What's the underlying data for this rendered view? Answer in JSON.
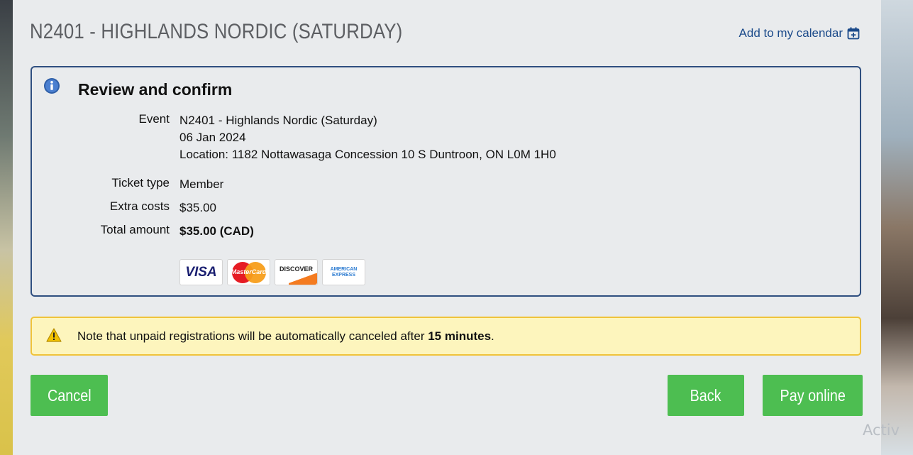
{
  "page": {
    "title": "N2401 - HIGHLANDS NORDIC (SATURDAY)",
    "calendar_link": "Add to my calendar"
  },
  "review": {
    "heading": "Review and confirm",
    "event_label": "Event",
    "event_name": "N2401 - Highlands Nordic (Saturday)",
    "event_date": "06 Jan 2024",
    "event_location": "Location: 1182 Nottawasaga Concession 10 S Duntroon, ON L0M 1H0",
    "ticket_label": "Ticket type",
    "ticket_value": "Member",
    "extra_label": "Extra costs",
    "extra_value": "$35.00",
    "total_label": "Total amount",
    "total_value": "$35.00 (CAD)",
    "payment_cards": [
      {
        "name": "VISA",
        "icon": "visa-card-icon"
      },
      {
        "name": "MasterCard",
        "icon": "mastercard-icon"
      },
      {
        "name": "DISCOVER",
        "icon": "discover-card-icon"
      },
      {
        "name": "AMERICAN EXPRESS",
        "icon": "amex-card-icon"
      }
    ]
  },
  "warning": {
    "text_before": "Note that unpaid registrations will be automatically canceled after ",
    "text_bold": "15 minutes",
    "text_after": "."
  },
  "buttons": {
    "cancel": "Cancel",
    "back": "Back",
    "pay": "Pay online"
  },
  "watermark": "Activ",
  "colors": {
    "button_green": "#4dbe51",
    "link_blue": "#1b4a8a",
    "box_border": "#2f4f80",
    "warning_bg": "#fdf5bd",
    "warning_border": "#f0c33a"
  }
}
